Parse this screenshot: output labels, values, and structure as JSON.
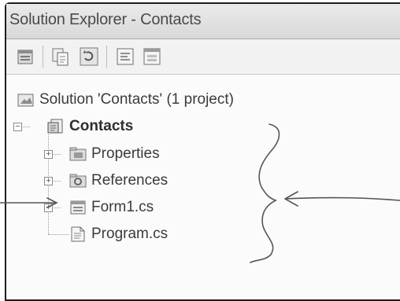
{
  "window": {
    "title": "Solution Explorer - Contacts"
  },
  "toolbar": {
    "buttons": [
      {
        "icon": "properties-icon"
      },
      {
        "icon": "show-all-files-icon"
      },
      {
        "icon": "refresh-icon"
      },
      {
        "icon": "view-code-icon"
      },
      {
        "icon": "view-designer-icon"
      }
    ]
  },
  "tree": {
    "solution": {
      "label": "Solution 'Contacts' (1 project)",
      "icon": "solution-icon"
    },
    "project": {
      "label": "Contacts",
      "icon": "project-icon",
      "expanded": true
    },
    "items": [
      {
        "label": "Properties",
        "icon": "properties-folder-icon",
        "expandable": true
      },
      {
        "label": "References",
        "icon": "references-folder-icon",
        "expandable": true
      },
      {
        "label": "Form1.cs",
        "icon": "form-file-icon",
        "expandable": true
      },
      {
        "label": "Program.cs",
        "icon": "cs-file-icon",
        "expandable": false
      }
    ]
  },
  "colors": {
    "annotation_ink": "#555555"
  }
}
